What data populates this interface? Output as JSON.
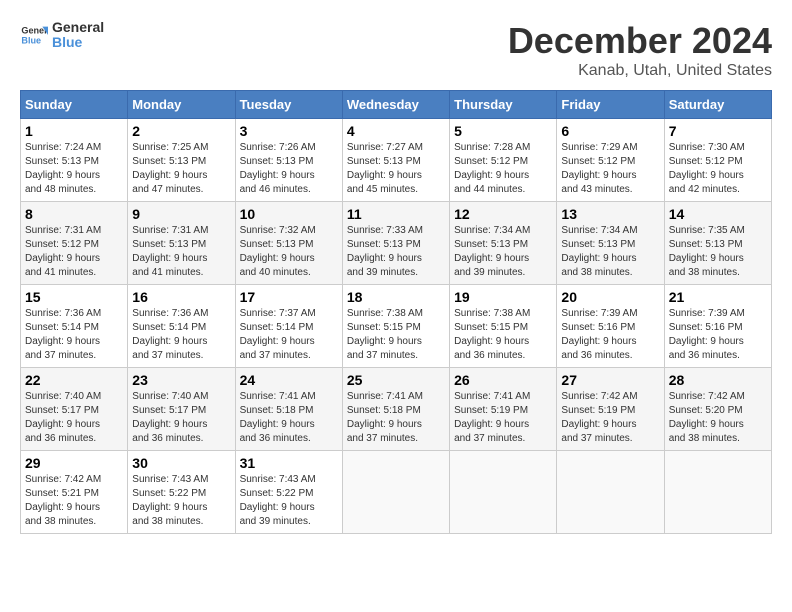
{
  "header": {
    "logo_line1": "General",
    "logo_line2": "Blue",
    "month": "December 2024",
    "location": "Kanab, Utah, United States"
  },
  "days_of_week": [
    "Sunday",
    "Monday",
    "Tuesday",
    "Wednesday",
    "Thursday",
    "Friday",
    "Saturday"
  ],
  "weeks": [
    [
      {
        "day": "1",
        "sunrise": "7:24 AM",
        "sunset": "5:13 PM",
        "daylight": "9 hours and 48 minutes."
      },
      {
        "day": "2",
        "sunrise": "7:25 AM",
        "sunset": "5:13 PM",
        "daylight": "9 hours and 47 minutes."
      },
      {
        "day": "3",
        "sunrise": "7:26 AM",
        "sunset": "5:13 PM",
        "daylight": "9 hours and 46 minutes."
      },
      {
        "day": "4",
        "sunrise": "7:27 AM",
        "sunset": "5:13 PM",
        "daylight": "9 hours and 45 minutes."
      },
      {
        "day": "5",
        "sunrise": "7:28 AM",
        "sunset": "5:12 PM",
        "daylight": "9 hours and 44 minutes."
      },
      {
        "day": "6",
        "sunrise": "7:29 AM",
        "sunset": "5:12 PM",
        "daylight": "9 hours and 43 minutes."
      },
      {
        "day": "7",
        "sunrise": "7:30 AM",
        "sunset": "5:12 PM",
        "daylight": "9 hours and 42 minutes."
      }
    ],
    [
      {
        "day": "8",
        "sunrise": "7:31 AM",
        "sunset": "5:12 PM",
        "daylight": "9 hours and 41 minutes."
      },
      {
        "day": "9",
        "sunrise": "7:31 AM",
        "sunset": "5:13 PM",
        "daylight": "9 hours and 41 minutes."
      },
      {
        "day": "10",
        "sunrise": "7:32 AM",
        "sunset": "5:13 PM",
        "daylight": "9 hours and 40 minutes."
      },
      {
        "day": "11",
        "sunrise": "7:33 AM",
        "sunset": "5:13 PM",
        "daylight": "9 hours and 39 minutes."
      },
      {
        "day": "12",
        "sunrise": "7:34 AM",
        "sunset": "5:13 PM",
        "daylight": "9 hours and 39 minutes."
      },
      {
        "day": "13",
        "sunrise": "7:34 AM",
        "sunset": "5:13 PM",
        "daylight": "9 hours and 38 minutes."
      },
      {
        "day": "14",
        "sunrise": "7:35 AM",
        "sunset": "5:13 PM",
        "daylight": "9 hours and 38 minutes."
      }
    ],
    [
      {
        "day": "15",
        "sunrise": "7:36 AM",
        "sunset": "5:14 PM",
        "daylight": "9 hours and 37 minutes."
      },
      {
        "day": "16",
        "sunrise": "7:36 AM",
        "sunset": "5:14 PM",
        "daylight": "9 hours and 37 minutes."
      },
      {
        "day": "17",
        "sunrise": "7:37 AM",
        "sunset": "5:14 PM",
        "daylight": "9 hours and 37 minutes."
      },
      {
        "day": "18",
        "sunrise": "7:38 AM",
        "sunset": "5:15 PM",
        "daylight": "9 hours and 37 minutes."
      },
      {
        "day": "19",
        "sunrise": "7:38 AM",
        "sunset": "5:15 PM",
        "daylight": "9 hours and 36 minutes."
      },
      {
        "day": "20",
        "sunrise": "7:39 AM",
        "sunset": "5:16 PM",
        "daylight": "9 hours and 36 minutes."
      },
      {
        "day": "21",
        "sunrise": "7:39 AM",
        "sunset": "5:16 PM",
        "daylight": "9 hours and 36 minutes."
      }
    ],
    [
      {
        "day": "22",
        "sunrise": "7:40 AM",
        "sunset": "5:17 PM",
        "daylight": "9 hours and 36 minutes."
      },
      {
        "day": "23",
        "sunrise": "7:40 AM",
        "sunset": "5:17 PM",
        "daylight": "9 hours and 36 minutes."
      },
      {
        "day": "24",
        "sunrise": "7:41 AM",
        "sunset": "5:18 PM",
        "daylight": "9 hours and 36 minutes."
      },
      {
        "day": "25",
        "sunrise": "7:41 AM",
        "sunset": "5:18 PM",
        "daylight": "9 hours and 37 minutes."
      },
      {
        "day": "26",
        "sunrise": "7:41 AM",
        "sunset": "5:19 PM",
        "daylight": "9 hours and 37 minutes."
      },
      {
        "day": "27",
        "sunrise": "7:42 AM",
        "sunset": "5:19 PM",
        "daylight": "9 hours and 37 minutes."
      },
      {
        "day": "28",
        "sunrise": "7:42 AM",
        "sunset": "5:20 PM",
        "daylight": "9 hours and 38 minutes."
      }
    ],
    [
      {
        "day": "29",
        "sunrise": "7:42 AM",
        "sunset": "5:21 PM",
        "daylight": "9 hours and 38 minutes."
      },
      {
        "day": "30",
        "sunrise": "7:43 AM",
        "sunset": "5:22 PM",
        "daylight": "9 hours and 38 minutes."
      },
      {
        "day": "31",
        "sunrise": "7:43 AM",
        "sunset": "5:22 PM",
        "daylight": "9 hours and 39 minutes."
      },
      null,
      null,
      null,
      null
    ]
  ],
  "labels": {
    "sunrise": "Sunrise:",
    "sunset": "Sunset:",
    "daylight": "Daylight:"
  }
}
